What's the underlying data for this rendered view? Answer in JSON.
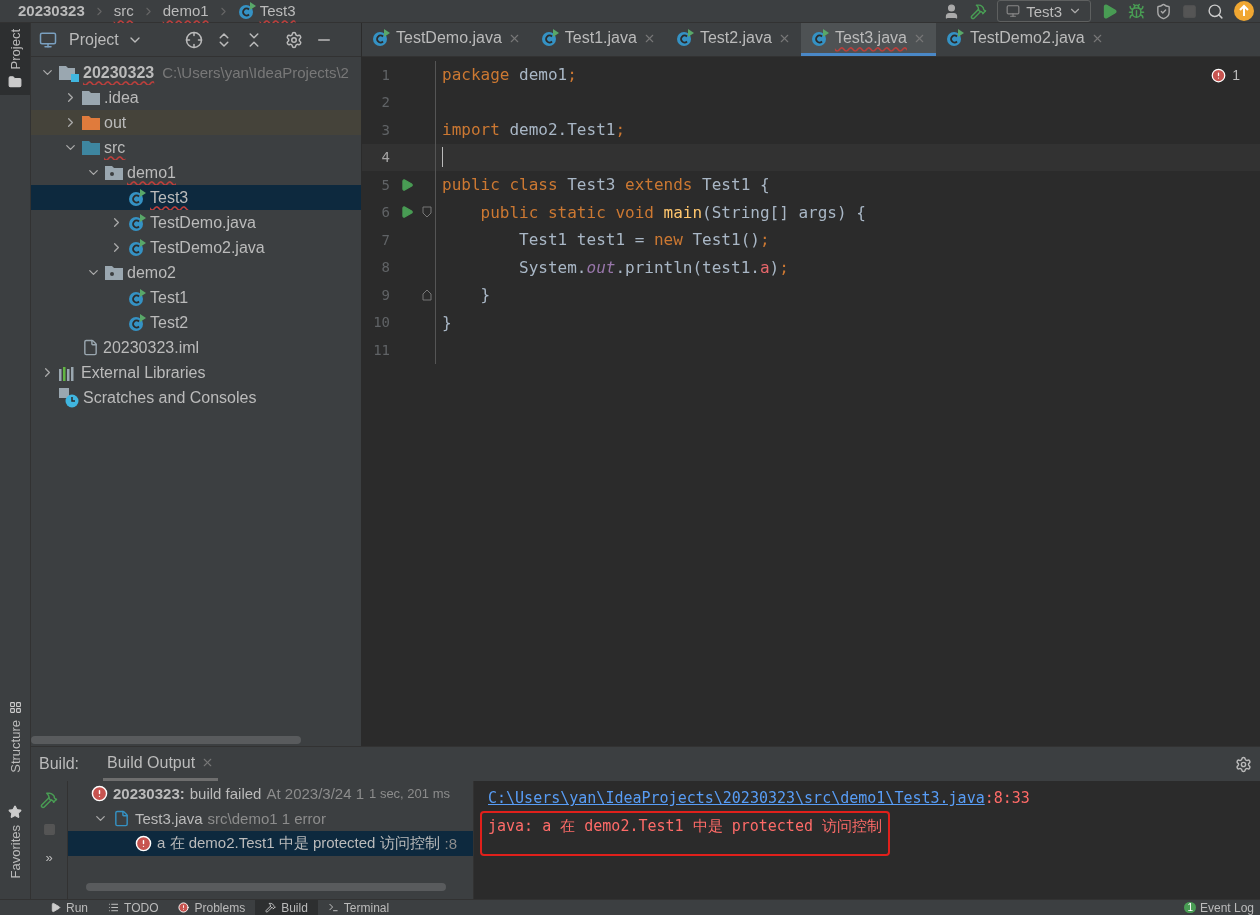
{
  "breadcrumbs": [
    {
      "label": "20230323",
      "kind": "project",
      "error": false
    },
    {
      "label": "src",
      "kind": "folder",
      "error": true
    },
    {
      "label": "demo1",
      "kind": "folder",
      "error": true
    },
    {
      "label": "Test3",
      "kind": "class",
      "error": true
    }
  ],
  "run_config": {
    "label": "Test3"
  },
  "left_stripe": [
    {
      "label": "Project",
      "kind": "project",
      "selected": true
    },
    {
      "label": "Structure",
      "kind": "structure",
      "selected": false
    },
    {
      "label": "Favorites",
      "kind": "favorites",
      "selected": false
    }
  ],
  "project_panel": {
    "title": "Project",
    "tree": [
      {
        "label": "20230323",
        "detail": "C:\\Users\\yan\\IdeaProjects\\2",
        "kind": "module",
        "expanded": true,
        "selected": false,
        "error": true,
        "children": [
          {
            "label": ".idea",
            "kind": "folder",
            "expanded": false,
            "selected": false,
            "error": false
          },
          {
            "label": "out",
            "kind": "excluded",
            "expanded": false,
            "selected": false,
            "error": false
          },
          {
            "label": "src",
            "kind": "source",
            "expanded": true,
            "selected": false,
            "error": true,
            "children": [
              {
                "label": "demo1",
                "kind": "package",
                "expanded": true,
                "selected": false,
                "error": true,
                "children": [
                  {
                    "label": "Test3",
                    "kind": "class",
                    "selected": true,
                    "error": true
                  },
                  {
                    "label": "TestDemo.java",
                    "kind": "class",
                    "expanded": false,
                    "selected": false,
                    "error": false
                  },
                  {
                    "label": "TestDemo2.java",
                    "kind": "class",
                    "expanded": false,
                    "selected": false,
                    "error": false
                  }
                ]
              },
              {
                "label": "demo2",
                "kind": "package",
                "expanded": true,
                "selected": false,
                "error": false,
                "children": [
                  {
                    "label": "Test1",
                    "kind": "class",
                    "selected": false,
                    "error": false
                  },
                  {
                    "label": "Test2",
                    "kind": "class",
                    "selected": false,
                    "error": false
                  }
                ]
              }
            ]
          },
          {
            "label": "20230323.iml",
            "kind": "file",
            "selected": false,
            "error": false
          }
        ]
      },
      {
        "label": "External Libraries",
        "kind": "libraries",
        "expanded": false,
        "selected": false,
        "error": false
      },
      {
        "label": "Scratches and Consoles",
        "kind": "scratches",
        "selected": false,
        "error": false
      }
    ]
  },
  "tabs": [
    {
      "label": "TestDemo.java",
      "selected": false,
      "error": false
    },
    {
      "label": "Test1.java",
      "selected": false,
      "error": false
    },
    {
      "label": "Test2.java",
      "selected": false,
      "error": false
    },
    {
      "label": "Test3.java",
      "selected": true,
      "error": true
    },
    {
      "label": "TestDemo2.java",
      "selected": false,
      "error": false
    }
  ],
  "editor": {
    "error_count": "1",
    "lines": [
      {
        "number": "1",
        "current": false,
        "tokens": [
          {
            "text": "package",
            "kind": "keyword"
          },
          {
            "text": " demo1",
            "kind": "plain"
          },
          {
            "text": ";",
            "kind": "keyword"
          }
        ]
      },
      {
        "number": "2",
        "current": false
      },
      {
        "number": "3",
        "current": false,
        "tokens": [
          {
            "text": "import",
            "kind": "keyword"
          },
          {
            "text": " demo2.Test1",
            "kind": "plain"
          },
          {
            "text": ";",
            "kind": "keyword"
          }
        ]
      },
      {
        "number": "4",
        "current": true
      },
      {
        "number": "5",
        "current": false,
        "runnable": true,
        "tokens": [
          {
            "text": "public class",
            "kind": "keyword"
          },
          {
            "text": " Test3 ",
            "kind": "plain"
          },
          {
            "text": "extends",
            "kind": "keyword"
          },
          {
            "text": " Test1 {",
            "kind": "plain"
          }
        ]
      },
      {
        "number": "6",
        "current": false,
        "runnable": true,
        "fold_start": true,
        "tokens": [
          {
            "text": "    public static void ",
            "kind": "keyword"
          },
          {
            "text": "main",
            "kind": "method"
          },
          {
            "text": "(String[] args) {",
            "kind": "plain"
          }
        ]
      },
      {
        "number": "7",
        "current": false,
        "tokens": [
          {
            "text": "        Test1 test1 = ",
            "kind": "plain"
          },
          {
            "text": "new",
            "kind": "keyword"
          },
          {
            "text": " Test1()",
            "kind": "plain"
          },
          {
            "text": ";",
            "kind": "keyword"
          }
        ]
      },
      {
        "number": "8",
        "current": false,
        "tokens": [
          {
            "text": "        System.",
            "kind": "plain"
          },
          {
            "text": "out",
            "kind": "field"
          },
          {
            "text": ".println(test1.",
            "kind": "plain"
          },
          {
            "text": "a",
            "kind": "error"
          },
          {
            "text": ")",
            "kind": "plain"
          },
          {
            "text": ";",
            "kind": "keyword"
          }
        ]
      },
      {
        "number": "9",
        "current": false,
        "fold_end": true,
        "tokens": [
          {
            "text": "    }",
            "kind": "plain"
          }
        ]
      },
      {
        "number": "10",
        "current": false,
        "tokens": [
          {
            "text": "}",
            "kind": "plain"
          }
        ]
      },
      {
        "number": "11",
        "current": false
      }
    ]
  },
  "build": {
    "label": "Build:",
    "more": "»",
    "tabs": [
      {
        "label": "Build Output",
        "selected": true
      }
    ],
    "tree": [
      {
        "kind": "summary",
        "title": "20230323:",
        "text": "build failed",
        "detail": "At 2023/3/24 1",
        "duration": "1 sec, 201 ms",
        "selected": false,
        "children": [
          {
            "kind": "file",
            "title": "Test3.java",
            "detail": "src\\demo1 1 error",
            "expanded": true,
            "selected": false,
            "children": [
              {
                "kind": "message",
                "title": "a 在 demo2.Test1 中是 protected 访问控制",
                "detail": ":8",
                "selected": true
              }
            ]
          }
        ]
      }
    ],
    "output": {
      "link": "C:\\Users\\yan\\IdeaProjects\\20230323\\src\\demo1\\Test3.java",
      "position": ":8:33",
      "message": "java: a 在 demo2.Test1 中是 protected 访问控制",
      "highlighted": true
    }
  },
  "bottom_tabs": [
    {
      "label": "Run",
      "kind": "run",
      "selected": false
    },
    {
      "label": "TODO",
      "kind": "todo",
      "selected": false
    },
    {
      "label": "Problems",
      "kind": "problems",
      "selected": false
    },
    {
      "label": "Build",
      "kind": "build",
      "selected": true
    },
    {
      "label": "Terminal",
      "kind": "terminal",
      "selected": false
    }
  ],
  "event_log": {
    "label": "Event Log",
    "count": "1"
  }
}
